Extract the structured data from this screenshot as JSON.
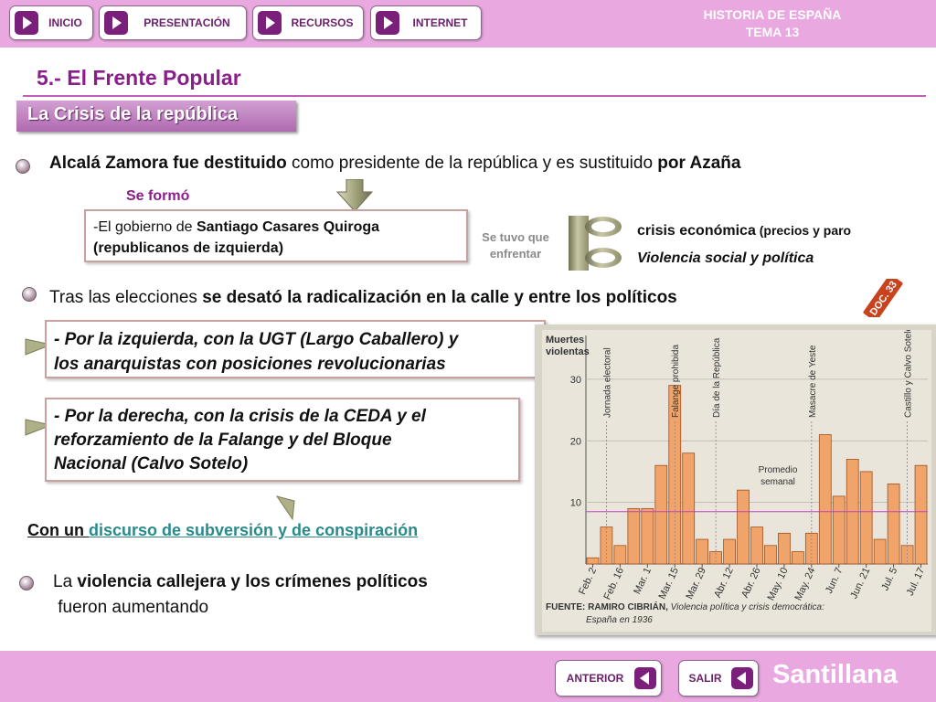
{
  "nav": {
    "inicio": "INICIO",
    "presentacion": "PRESENTACIÓN",
    "recursos": "RECURSOS",
    "internet": "INTERNET"
  },
  "header": {
    "line1": "HISTORIA DE ESPAÑA",
    "line2": "TEMA 13"
  },
  "title": "5.- El Frente Popular",
  "subtitle": "La Crisis de la república",
  "point1": {
    "b1": "Alcalá Zamora fue destituido",
    "t1": " como presidente de la república y es sustituido ",
    "b2": "por Azaña"
  },
  "se_formo": "Se formó",
  "gobierno": {
    "t1": "-El gobierno de ",
    "b1": "Santiago Casares Quiroga",
    "line2": "(republicanos de izquierda)"
  },
  "se_tuvo": {
    "line1": "Se tuvo que",
    "line2": "enfrentar"
  },
  "crisis": {
    "b1": "crisis económica",
    "small": " (precios y paro",
    "line2": "Violencia social y política"
  },
  "point2": {
    "t1": "Tras las elecciones ",
    "b1": "se desató la radicalización",
    "t2": "  en la calle y entre los políticos"
  },
  "izquierda": {
    "line1": "- Por la izquierda, con la UGT (Largo Caballero) y",
    "line2": "los anarquistas con posiciones revolucionarias"
  },
  "derecha": {
    "line1": "- Por la derecha, con la crisis de la CEDA y el",
    "line2": "reforzamiento de la Falange y del Bloque",
    "line3": "Nacional (Calvo Sotelo)"
  },
  "discurso": {
    "t1": "Con un ",
    "link": "discurso de subversión y de conspiración"
  },
  "point3": {
    "t1": "La ",
    "b1": "violencia callejera y los crímenes políticos",
    "line2": " fueron aumentando"
  },
  "doc_label": "DOC. 33",
  "chart_data": {
    "type": "bar",
    "ylabel": "Muertes violentas",
    "ylim": [
      0,
      38
    ],
    "yticks": [
      10,
      20,
      30
    ],
    "values": [
      1,
      6,
      3,
      9,
      9,
      16,
      29,
      18,
      4,
      2,
      4,
      12,
      6,
      3,
      5,
      2,
      5,
      21,
      11,
      17,
      15,
      4,
      13,
      3,
      16
    ],
    "date_ticks": [
      {
        "label": "Feb. 2",
        "index": 0
      },
      {
        "label": "Feb. 16",
        "index": 2
      },
      {
        "label": "Mar. 1",
        "index": 4
      },
      {
        "label": "Mar. 15",
        "index": 6
      },
      {
        "label": "Mar. 29",
        "index": 8
      },
      {
        "label": "Abr. 12",
        "index": 10
      },
      {
        "label": "Abr. 26",
        "index": 12
      },
      {
        "label": "May. 10",
        "index": 14
      },
      {
        "label": "May. 24",
        "index": 16
      },
      {
        "label": "Jun. 7",
        "index": 18
      },
      {
        "label": "Jun. 21",
        "index": 20
      },
      {
        "label": "Jul. 5",
        "index": 22
      },
      {
        "label": "Jul. 17",
        "index": 24
      }
    ],
    "events": [
      {
        "label": "Jornada electoral",
        "index": 1
      },
      {
        "label": "Falange prohibida",
        "index": 6
      },
      {
        "label": "Día de la República",
        "index": 9
      },
      {
        "label": "Masacre de Yeste",
        "index": 16
      },
      {
        "label": "Castillo y Calvo Sotelo asesinados",
        "index": 23
      }
    ],
    "average_label": "Promedio semanal",
    "average": 8.5,
    "source_prefix": "FUENTE: RAMIRO CIBRIÁN, ",
    "source_title": "Violencia política y crisis democrática:",
    "source_line2": "España en 1936",
    "colors": {
      "bar": "#f0a46a",
      "bar_stroke": "#a05020",
      "grid": "#b9b5ab",
      "average": "#c040c0"
    }
  },
  "footer": {
    "anterior": "ANTERIOR",
    "salir": "SALIR",
    "brand": "Santillana"
  }
}
